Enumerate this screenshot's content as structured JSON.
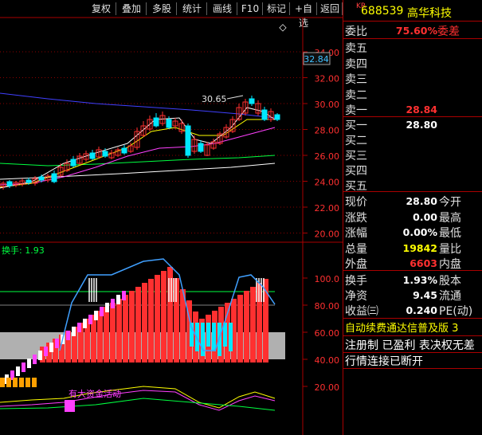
{
  "toolbar": {
    "buttons": [
      "复权",
      "叠加",
      "多股",
      "统计",
      "画线",
      "F10",
      "标记",
      "+自选",
      "返回"
    ]
  },
  "main_chart": {
    "price_labels": [
      "34.00",
      "32.00",
      "30.00",
      "28.00",
      "26.00",
      "24.00",
      "22.00",
      "20.00"
    ],
    "current_price_tag": "32.84",
    "high_annotation": "30.65",
    "collapse_symbol": "◇",
    "colors": {
      "up": "#ff3030",
      "down": "#00e8ff",
      "ma5": "#ffffff",
      "ma10": "#ffff00",
      "ma20": "#ff40ff",
      "ma60": "#00ff40",
      "ma120": "#4040ff",
      "grid": "#8b0000"
    }
  },
  "indicator": {
    "title": "换手: 1.93",
    "scale_labels": [
      "100.0",
      "80.00",
      "60.00",
      "40.00",
      "20.00"
    ],
    "annotation": "有大资金活动"
  },
  "quote": {
    "exchange_badge": "KR",
    "code": "688539",
    "name": "高华科技",
    "weibi_label": "委比",
    "weibi_value": "75.60%",
    "weicha_label": "委差",
    "sell": [
      {
        "label": "卖五",
        "price": ""
      },
      {
        "label": "卖四",
        "price": ""
      },
      {
        "label": "卖三",
        "price": ""
      },
      {
        "label": "卖二",
        "price": ""
      },
      {
        "label": "卖一",
        "price": "28.84"
      }
    ],
    "buy": [
      {
        "label": "买一",
        "price": "28.80"
      },
      {
        "label": "买二",
        "price": ""
      },
      {
        "label": "买三",
        "price": ""
      },
      {
        "label": "买四",
        "price": ""
      },
      {
        "label": "买五",
        "price": ""
      }
    ],
    "stats": [
      {
        "l1": "现价",
        "v1": "28.80",
        "l2": "今开",
        "c": "#ffffff"
      },
      {
        "l1": "涨跌",
        "v1": "0.00",
        "l2": "最高",
        "c": "#ffffff"
      },
      {
        "l1": "涨幅",
        "v1": "0.00%",
        "l2": "最低",
        "c": "#ffffff"
      },
      {
        "l1": "总量",
        "v1": "19842",
        "l2": "量比",
        "c": "#ffff00"
      },
      {
        "l1": "外盘",
        "v1": "6603",
        "l2": "内盘",
        "c": "#ff3030"
      }
    ],
    "fin": [
      {
        "l1": "换手",
        "v1": "1.93%",
        "l2": "股本"
      },
      {
        "l1": "净资",
        "v1": "9.45",
        "l2": "流通"
      },
      {
        "l1": "收益㈢",
        "v1": "0.240",
        "l2": "PE(动)"
      }
    ],
    "scroll_text": "自动续费通达信普及版  3",
    "notice1": "注册制 已盈利 表决权无差",
    "notice2": "行情连接已断开"
  }
}
